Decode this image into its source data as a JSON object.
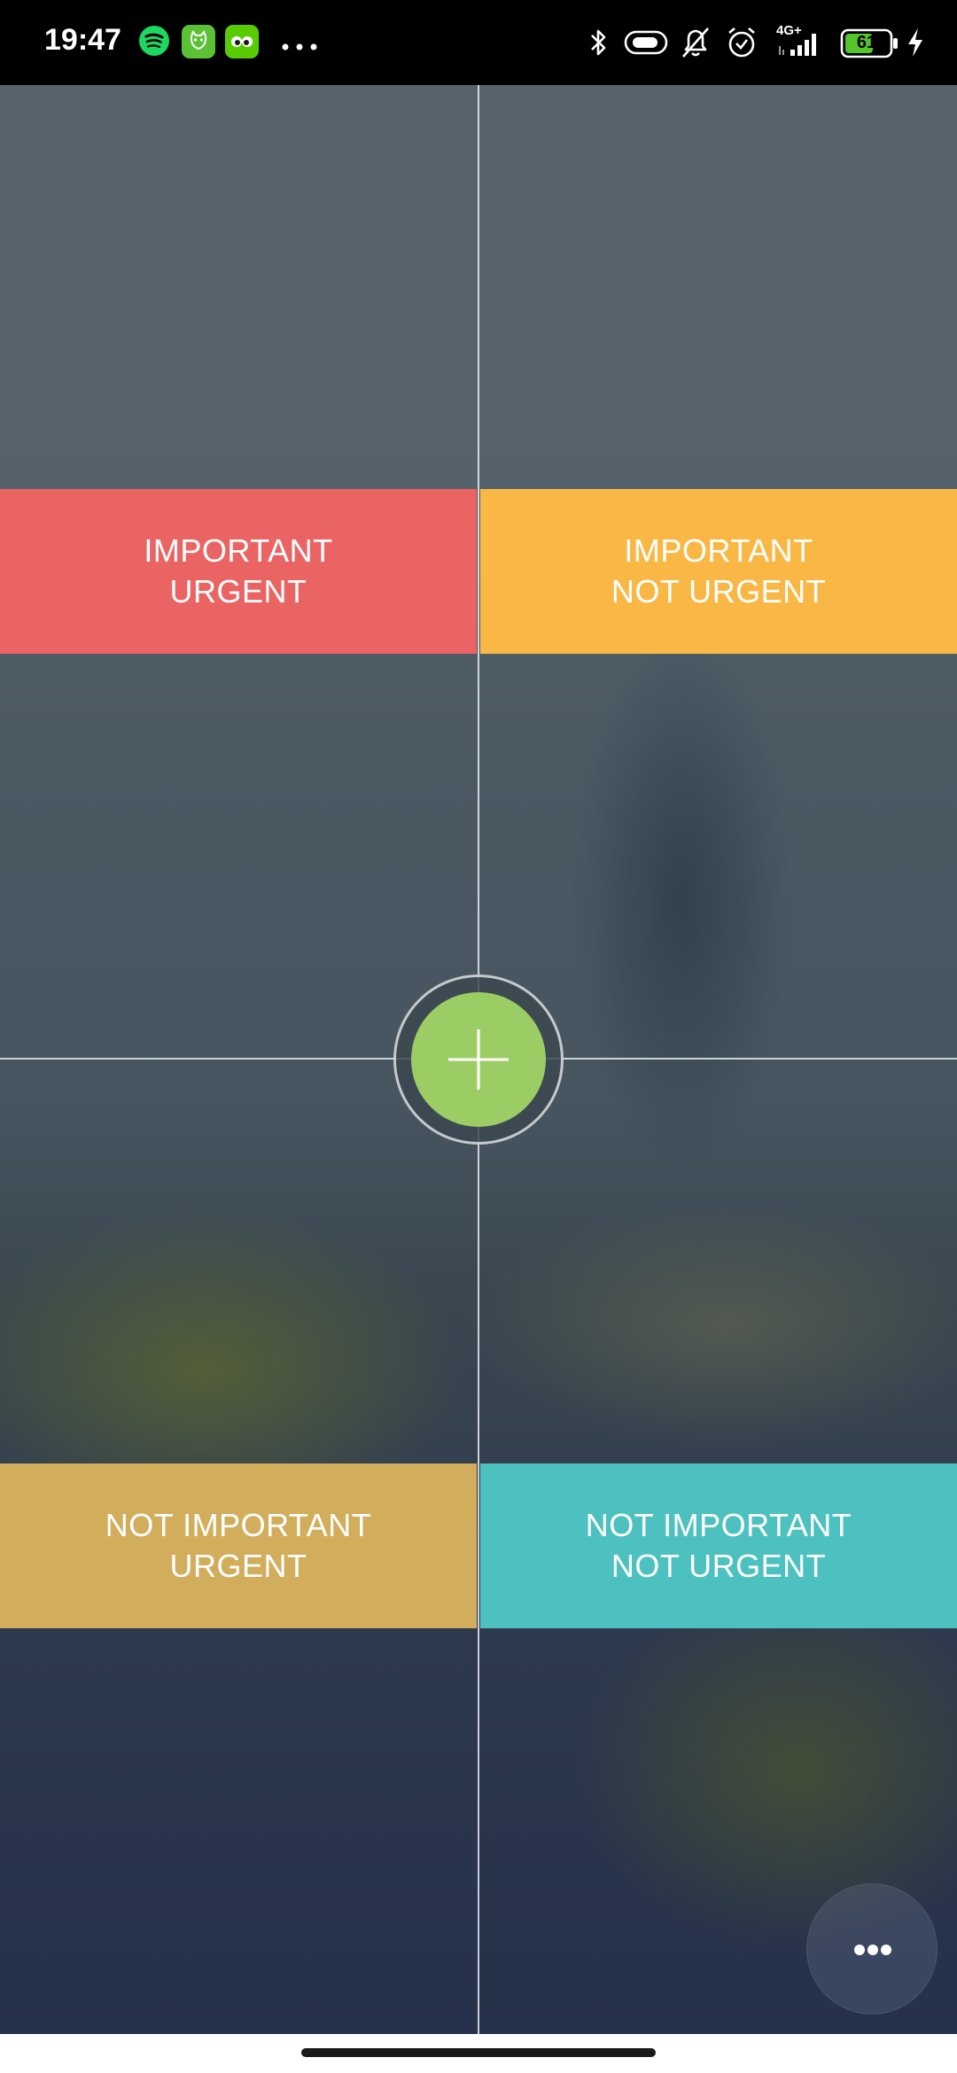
{
  "status_bar": {
    "time": "19:47",
    "network": "4G+",
    "battery": "61",
    "icons": [
      "spotify-icon",
      "cat-app-icon",
      "duolingo-icon",
      "more-notifications-icon",
      "bluetooth-icon",
      "toggle-icon",
      "bell-muted-icon",
      "alarm-icon",
      "signal-icon",
      "battery-icon",
      "charging-icon"
    ]
  },
  "quadrants": {
    "important_urgent": {
      "line1": "IMPORTANT",
      "line2": "URGENT",
      "color": "#e96463"
    },
    "important_not_urgent": {
      "line1": "IMPORTANT",
      "line2": "NOT URGENT",
      "color": "#f9b845"
    },
    "not_important_urgent": {
      "line1": "NOT IMPORTANT",
      "line2": "URGENT",
      "color": "#d1ad5c"
    },
    "not_important_not_urgent": {
      "line1": "NOT IMPORTANT",
      "line2": "NOT URGENT",
      "color": "#4dc1c0"
    }
  },
  "add_button": {
    "icon": "plus-icon",
    "color": "#9ccd64"
  },
  "more_button": {
    "icon": "more-horizontal-icon"
  }
}
